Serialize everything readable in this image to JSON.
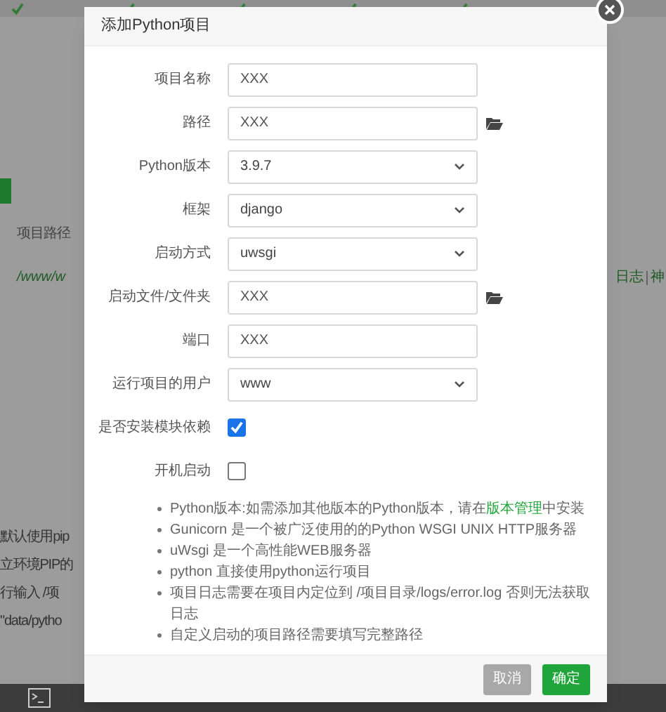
{
  "background": {
    "table_header": "项目路径",
    "table_row_path": "/www/w",
    "row_links": [
      "日志",
      "神"
    ],
    "hint_lines": [
      "默认使用pip",
      "立环境PIP的",
      "行输入 /项",
      "\"data/pytho"
    ]
  },
  "modal": {
    "title": "添加Python项目",
    "fields": [
      {
        "kind": "text",
        "label": "项目名称",
        "value": "XXX"
      },
      {
        "kind": "browse",
        "label": "路径",
        "value": "XXX"
      },
      {
        "kind": "select",
        "label": "Python版本",
        "value": "3.9.7"
      },
      {
        "kind": "select",
        "label": "框架",
        "value": "django"
      },
      {
        "kind": "select",
        "label": "启动方式",
        "value": "uwsgi"
      },
      {
        "kind": "browse",
        "label": "启动文件/文件夹",
        "value": "XXX"
      },
      {
        "kind": "text",
        "label": "端口",
        "value": "XXX"
      },
      {
        "kind": "select",
        "label": "运行项目的用户",
        "value": "www"
      },
      {
        "kind": "checkbox",
        "label": "是否安装模块依赖",
        "checked": true
      },
      {
        "kind": "checkbox",
        "label": "开机启动",
        "checked": false
      }
    ],
    "notes": [
      {
        "text": "Python版本:如需添加其他版本的Python版本，请在",
        "link": "版本管理",
        "after": "中安装"
      },
      {
        "text": "Gunicorn 是一个被广泛使用的的Python WSGI UNIX HTTP服务器"
      },
      {
        "text": "uWsgi 是一个高性能WEB服务器"
      },
      {
        "text": "python 直接使用python运行项目"
      },
      {
        "text": "项目日志需要在项目内定位到 /项目目录/logs/error.log 否则无法获取日志"
      },
      {
        "text": "自定义启动的项目路径需要填写完整路径"
      }
    ],
    "buttons": [
      {
        "kind": "cancel",
        "label": "取消"
      },
      {
        "kind": "confirm",
        "label": "确定"
      }
    ]
  }
}
